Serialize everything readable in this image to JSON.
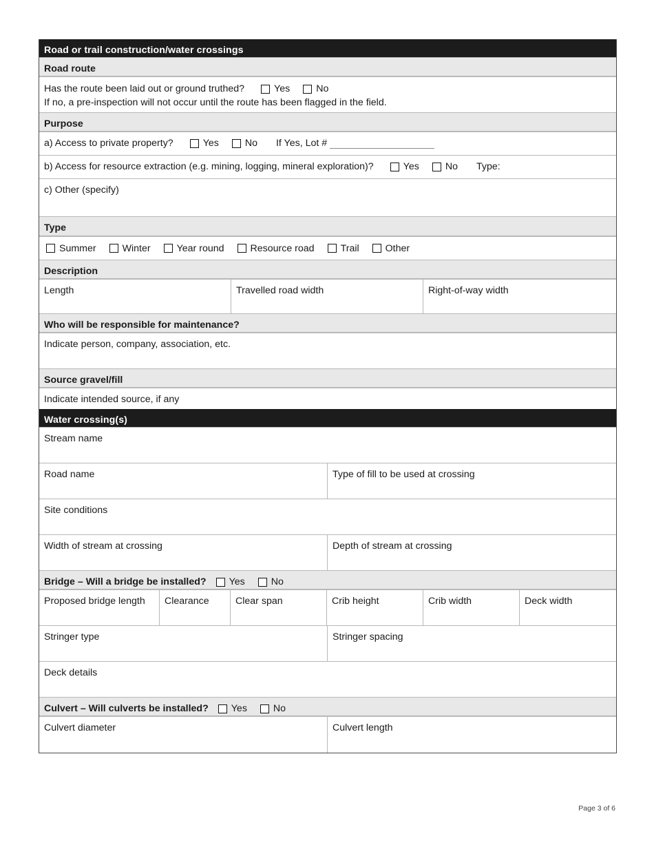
{
  "document": {
    "footer": "Page 3 of 6"
  },
  "sections": {
    "road": {
      "title": "Road or trail construction/water crossings",
      "road_route": {
        "header": "Road route",
        "question": "Has the route been laid out or ground truthed?",
        "yes_label": "Yes",
        "no_label": "No",
        "note": "If no, a pre-inspection will not occur until the route has been flagged in the field."
      },
      "purpose": {
        "header": "Purpose",
        "a_label": "a) Access to private property?",
        "a_yes": "Yes",
        "a_no": "No",
        "a_lot": "If Yes, Lot #",
        "b_label": "b) Access for resource extraction (e.g. mining, logging, mineral exploration)?",
        "b_yes": "Yes",
        "b_no": "No",
        "b_type": "Type:",
        "c_label": "c) Other (specify)"
      },
      "type": {
        "header": "Type",
        "options": [
          "Summer",
          "Winter",
          "Year round",
          "Resource road",
          "Trail",
          "Other"
        ]
      },
      "description": {
        "header": "Description",
        "fields": [
          "Length",
          "Travelled road width",
          "Right-of-way width"
        ]
      },
      "maintenance": {
        "header": "Who will be responsible for maintenance?",
        "hint": "Indicate person, company, association, etc."
      },
      "source_gravel": {
        "header": "Source gravel/fill",
        "hint": "Indicate intended source, if any"
      }
    },
    "water": {
      "title": "Water crossing(s)",
      "stream_name": "Stream name",
      "road_name": "Road name",
      "fill_type": "Type of fill to be used at crossing",
      "site_conditions": "Site conditions",
      "width_of_stream": "Width of stream at crossing",
      "depth_of_stream": "Depth of stream at crossing",
      "bridge": {
        "header": "Bridge – Will a bridge be installed?",
        "yes_label": "Yes",
        "no_label": "No",
        "columns": [
          "Proposed bridge length",
          "Clearance",
          "Clear span",
          "Crib height",
          "Crib width",
          "Deck width"
        ],
        "stringer_type": "Stringer type",
        "stringer_spacing": "Stringer spacing",
        "deck_details": "Deck details"
      },
      "culvert": {
        "header": "Culvert – Will culverts be installed?",
        "yes_label": "Yes",
        "no_label": "No",
        "diameter": "Culvert diameter",
        "length": "Culvert length"
      }
    }
  },
  "colors": {
    "bar_black": "#1c1c1c",
    "bar_grey": "#e8e8e8",
    "border": "#4a4a4a",
    "inner_border": "#b8b8b8"
  }
}
